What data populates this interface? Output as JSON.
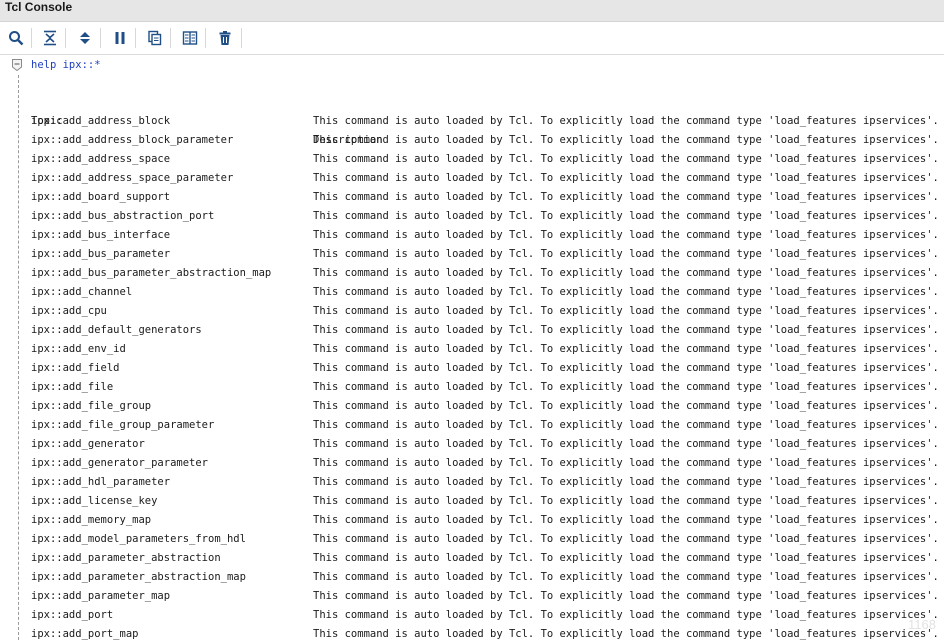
{
  "window": {
    "title": "Tcl Console"
  },
  "toolbar": {
    "buttons": [
      {
        "name": "search-button",
        "icon": "search-icon"
      },
      {
        "name": "collapse-all-button",
        "icon": "collapse-all-icon"
      },
      {
        "name": "expand-all-button",
        "icon": "expand-all-icon"
      },
      {
        "name": "pause-button",
        "icon": "pause-icon"
      },
      {
        "name": "copy-button",
        "icon": "copy-icon"
      },
      {
        "name": "columns-button",
        "icon": "columns-icon"
      },
      {
        "name": "clear-button",
        "icon": "trash-icon"
      }
    ]
  },
  "console": {
    "command": "help ipx::*",
    "header": {
      "topic": "Topic",
      "description": "Description"
    },
    "rows": [
      {
        "topic": "ipx::add_address_block",
        "description": "This command is auto loaded by Tcl. To explicitly load the command type 'load_features ipservices'."
      },
      {
        "topic": "ipx::add_address_block_parameter",
        "description": "This command is auto loaded by Tcl. To explicitly load the command type 'load_features ipservices'."
      },
      {
        "topic": "ipx::add_address_space",
        "description": "This command is auto loaded by Tcl. To explicitly load the command type 'load_features ipservices'."
      },
      {
        "topic": "ipx::add_address_space_parameter",
        "description": "This command is auto loaded by Tcl. To explicitly load the command type 'load_features ipservices'."
      },
      {
        "topic": "ipx::add_board_support",
        "description": "This command is auto loaded by Tcl. To explicitly load the command type 'load_features ipservices'."
      },
      {
        "topic": "ipx::add_bus_abstraction_port",
        "description": "This command is auto loaded by Tcl. To explicitly load the command type 'load_features ipservices'."
      },
      {
        "topic": "ipx::add_bus_interface",
        "description": "This command is auto loaded by Tcl. To explicitly load the command type 'load_features ipservices'."
      },
      {
        "topic": "ipx::add_bus_parameter",
        "description": "This command is auto loaded by Tcl. To explicitly load the command type 'load_features ipservices'."
      },
      {
        "topic": "ipx::add_bus_parameter_abstraction_map",
        "description": "This command is auto loaded by Tcl. To explicitly load the command type 'load_features ipservices'."
      },
      {
        "topic": "ipx::add_channel",
        "description": "This command is auto loaded by Tcl. To explicitly load the command type 'load_features ipservices'."
      },
      {
        "topic": "ipx::add_cpu",
        "description": "This command is auto loaded by Tcl. To explicitly load the command type 'load_features ipservices'."
      },
      {
        "topic": "ipx::add_default_generators",
        "description": "This command is auto loaded by Tcl. To explicitly load the command type 'load_features ipservices'."
      },
      {
        "topic": "ipx::add_env_id",
        "description": "This command is auto loaded by Tcl. To explicitly load the command type 'load_features ipservices'."
      },
      {
        "topic": "ipx::add_field",
        "description": "This command is auto loaded by Tcl. To explicitly load the command type 'load_features ipservices'."
      },
      {
        "topic": "ipx::add_file",
        "description": "This command is auto loaded by Tcl. To explicitly load the command type 'load_features ipservices'."
      },
      {
        "topic": "ipx::add_file_group",
        "description": "This command is auto loaded by Tcl. To explicitly load the command type 'load_features ipservices'."
      },
      {
        "topic": "ipx::add_file_group_parameter",
        "description": "This command is auto loaded by Tcl. To explicitly load the command type 'load_features ipservices'."
      },
      {
        "topic": "ipx::add_generator",
        "description": "This command is auto loaded by Tcl. To explicitly load the command type 'load_features ipservices'."
      },
      {
        "topic": "ipx::add_generator_parameter",
        "description": "This command is auto loaded by Tcl. To explicitly load the command type 'load_features ipservices'."
      },
      {
        "topic": "ipx::add_hdl_parameter",
        "description": "This command is auto loaded by Tcl. To explicitly load the command type 'load_features ipservices'."
      },
      {
        "topic": "ipx::add_license_key",
        "description": "This command is auto loaded by Tcl. To explicitly load the command type 'load_features ipservices'."
      },
      {
        "topic": "ipx::add_memory_map",
        "description": "This command is auto loaded by Tcl. To explicitly load the command type 'load_features ipservices'."
      },
      {
        "topic": "ipx::add_model_parameters_from_hdl",
        "description": "This command is auto loaded by Tcl. To explicitly load the command type 'load_features ipservices'."
      },
      {
        "topic": "ipx::add_parameter_abstraction",
        "description": "This command is auto loaded by Tcl. To explicitly load the command type 'load_features ipservices'."
      },
      {
        "topic": "ipx::add_parameter_abstraction_map",
        "description": "This command is auto loaded by Tcl. To explicitly load the command type 'load_features ipservices'."
      },
      {
        "topic": "ipx::add_parameter_map",
        "description": "This command is auto loaded by Tcl. To explicitly load the command type 'load_features ipservices'."
      },
      {
        "topic": "ipx::add_port",
        "description": "This command is auto loaded by Tcl. To explicitly load the command type 'load_features ipservices'."
      },
      {
        "topic": "ipx::add_port_map",
        "description": "This command is auto loaded by Tcl. To explicitly load the command type 'load_features ipservices'."
      }
    ]
  },
  "watermark": "1168",
  "colors": {
    "accent": "#1f5a9e",
    "command": "#1f3fbf",
    "titlebar": "#e6e6e6"
  }
}
